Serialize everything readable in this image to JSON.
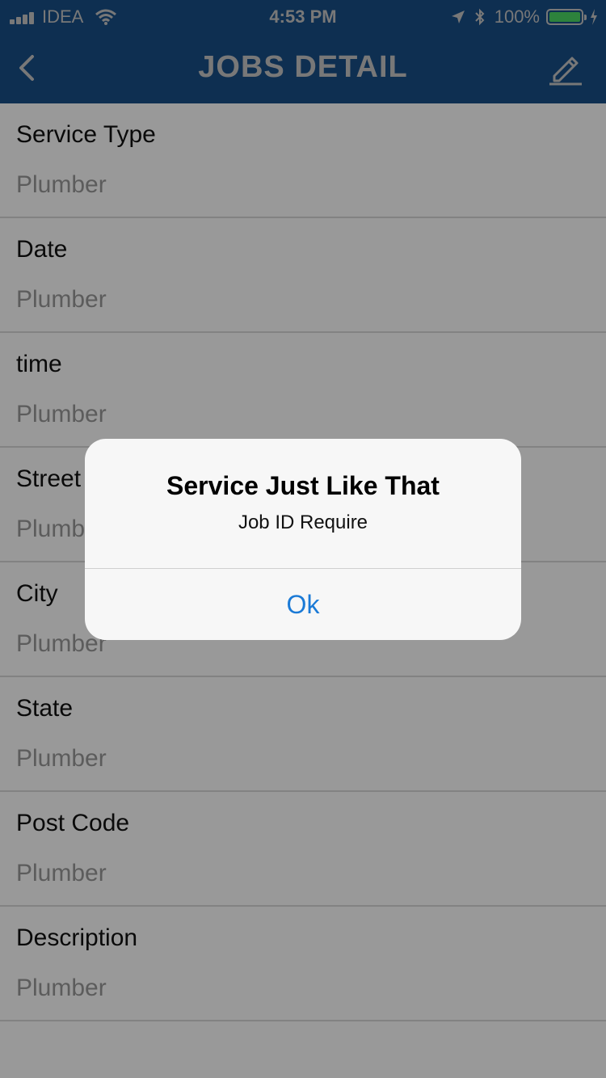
{
  "status_bar": {
    "carrier": "IDEA",
    "time": "4:53 PM",
    "battery_percent": "100%",
    "battery_level": 1.0,
    "icons": [
      "signal-icon",
      "wifi-icon",
      "location-icon",
      "bluetooth-icon",
      "battery-icon",
      "charging-icon"
    ]
  },
  "navbar": {
    "title": "JOBS DETAIL",
    "back_icon": "back-chevron-icon",
    "edit_icon": "edit-pencil-icon"
  },
  "fields": [
    {
      "label": "Service Type",
      "value": "Plumber"
    },
    {
      "label": "Date",
      "value": "Plumber"
    },
    {
      "label": "time",
      "value": "Plumber"
    },
    {
      "label": "Street",
      "value": "Plumber"
    },
    {
      "label": "City",
      "value": "Plumber"
    },
    {
      "label": "State",
      "value": "Plumber"
    },
    {
      "label": "Post Code",
      "value": "Plumber"
    },
    {
      "label": "Description",
      "value": "Plumber"
    }
  ],
  "alert": {
    "title": "Service Just Like That",
    "message": "Job ID Require",
    "ok_label": "Ok"
  },
  "colors": {
    "navbar": "#184f88",
    "accent": "#1b7ad6",
    "battery": "#4cd964"
  }
}
